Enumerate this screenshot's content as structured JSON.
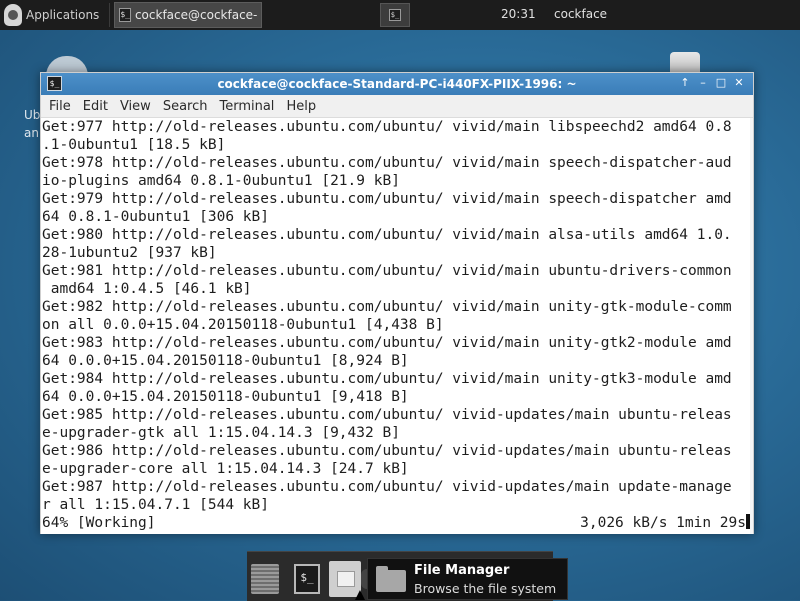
{
  "top_panel": {
    "applications_label": "Applications",
    "task_label": "cockface@cockface-Sta...",
    "task_icon_text": "$_",
    "workspace_icon_text": "$_",
    "clock": "20:31",
    "user": "cockface"
  },
  "desktop": {
    "partial_label_1": "Ub",
    "partial_label_2": "an"
  },
  "terminal": {
    "title": "cockface@cockface-Standard-PC-i440FX-PIIX-1996: ~",
    "icon_text": "$_",
    "controls": [
      "↑",
      "–",
      "□",
      "✕"
    ],
    "menu": [
      "File",
      "Edit",
      "View",
      "Search",
      "Terminal",
      "Help"
    ],
    "lines": [
      "Get:977 http://old-releases.ubuntu.com/ubuntu/ vivid/main libspeechd2 amd64 0.8",
      ".1-0ubuntu1 [18.5 kB]",
      "Get:978 http://old-releases.ubuntu.com/ubuntu/ vivid/main speech-dispatcher-aud",
      "io-plugins amd64 0.8.1-0ubuntu1 [21.9 kB]",
      "Get:979 http://old-releases.ubuntu.com/ubuntu/ vivid/main speech-dispatcher amd",
      "64 0.8.1-0ubuntu1 [306 kB]",
      "Get:980 http://old-releases.ubuntu.com/ubuntu/ vivid/main alsa-utils amd64 1.0.",
      "28-1ubuntu2 [937 kB]",
      "Get:981 http://old-releases.ubuntu.com/ubuntu/ vivid/main ubuntu-drivers-common",
      " amd64 1:0.4.5 [46.1 kB]",
      "Get:982 http://old-releases.ubuntu.com/ubuntu/ vivid/main unity-gtk-module-comm",
      "on all 0.0.0+15.04.20150118-0ubuntu1 [4,438 B]",
      "Get:983 http://old-releases.ubuntu.com/ubuntu/ vivid/main unity-gtk2-module amd",
      "64 0.0.0+15.04.20150118-0ubuntu1 [8,924 B]",
      "Get:984 http://old-releases.ubuntu.com/ubuntu/ vivid/main unity-gtk3-module amd",
      "64 0.0.0+15.04.20150118-0ubuntu1 [9,418 B]",
      "Get:985 http://old-releases.ubuntu.com/ubuntu/ vivid-updates/main ubuntu-releas",
      "e-upgrader-gtk all 1:15.04.14.3 [9,432 B]",
      "Get:986 http://old-releases.ubuntu.com/ubuntu/ vivid-updates/main ubuntu-releas",
      "e-upgrader-core all 1:15.04.14.3 [24.7 kB]",
      "Get:987 http://old-releases.ubuntu.com/ubuntu/ vivid-updates/main update-manage",
      "r all 1:15.04.7.1 [544 kB]"
    ],
    "status_left": "64% [Working]",
    "status_right": "3,026 kB/s 1min 29s"
  },
  "dock": {
    "terminal_icon_text": "$_"
  },
  "tooltip": {
    "title": "File Manager",
    "subtitle": "Browse the file system"
  }
}
